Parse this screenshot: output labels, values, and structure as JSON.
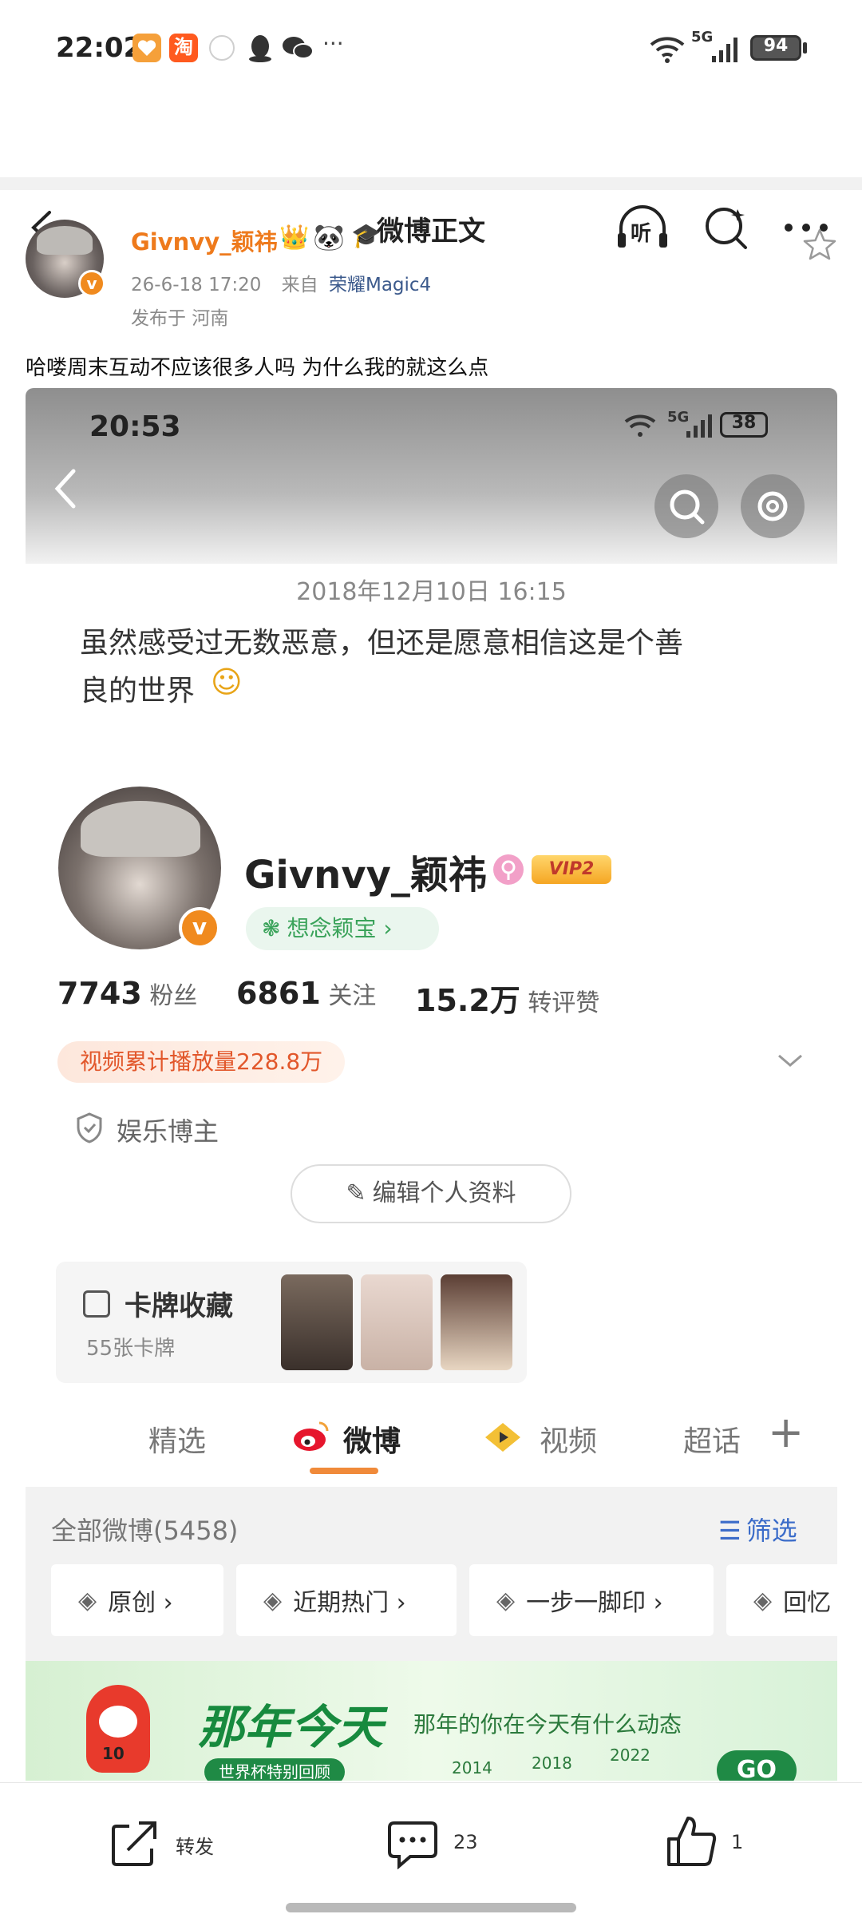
{
  "status_bar": {
    "time": "22:02",
    "network": "5G",
    "battery": "94",
    "overflow": "···",
    "app_icons": [
      "taobao-heart-icon",
      "taobao-icon",
      "weibo-icon",
      "qq-icon",
      "wechat-icon"
    ]
  },
  "nav": {
    "title": "微博正文",
    "listen_label": "听"
  },
  "post": {
    "username": "Givnvy_颖祎",
    "date": "26-6-18 17:20",
    "from_label": "来自",
    "device": "荣耀Magic4",
    "location": "发布于 河南",
    "text": "哈喽周末互动不应该很多人吗 为什么我的就这么点"
  },
  "embedded": {
    "status_time": "20:53",
    "network": "5G",
    "battery": "38",
    "intro_date": "2018年12月10日 16:15",
    "intro_line1": "虽然感受过无数恶意，但还是愿意相信这是个善",
    "intro_line2": "良的世界",
    "intro_emoji": "☺",
    "profile_name": "Givnvy_颖祎",
    "vip_label": "VIP2",
    "fan_group": "想念颖宝 ›",
    "stats": [
      {
        "value": "7743",
        "label": "粉丝"
      },
      {
        "value": "6861",
        "label": "关注"
      },
      {
        "value": "15.2万",
        "label": "转评赞"
      }
    ],
    "video_plays": "视频累计播放量228.8万",
    "category": "娱乐博主",
    "edit_profile": "编辑个人资料",
    "card_title": "卡牌收藏",
    "card_count": "55张卡牌",
    "tabs": [
      "精选",
      "微博",
      "视频",
      "超话"
    ],
    "active_tab": "微博",
    "tab_add": "+",
    "all_posts": "全部微博(5458)",
    "filter": "筛选",
    "chips": [
      "原创 ›",
      "近期热门 ›",
      "一步一脚印 ›",
      "回忆"
    ],
    "banner_title": "那年今天",
    "banner_sub": "那年的你在今天有什么动态",
    "banner_small": "世界杯特别回顾",
    "banner_years": [
      "2014",
      "2018",
      "2022"
    ],
    "banner_go": "GO",
    "mascot_number": "10"
  },
  "actions": {
    "repost_label": "转发",
    "comment_count": "23",
    "like_count": "1"
  },
  "colors": {
    "brand_orange": "#ee7a1c",
    "device_blue": "#3c5a8c",
    "tab_underline": "#f08a3a",
    "green": "#3aa35a"
  }
}
